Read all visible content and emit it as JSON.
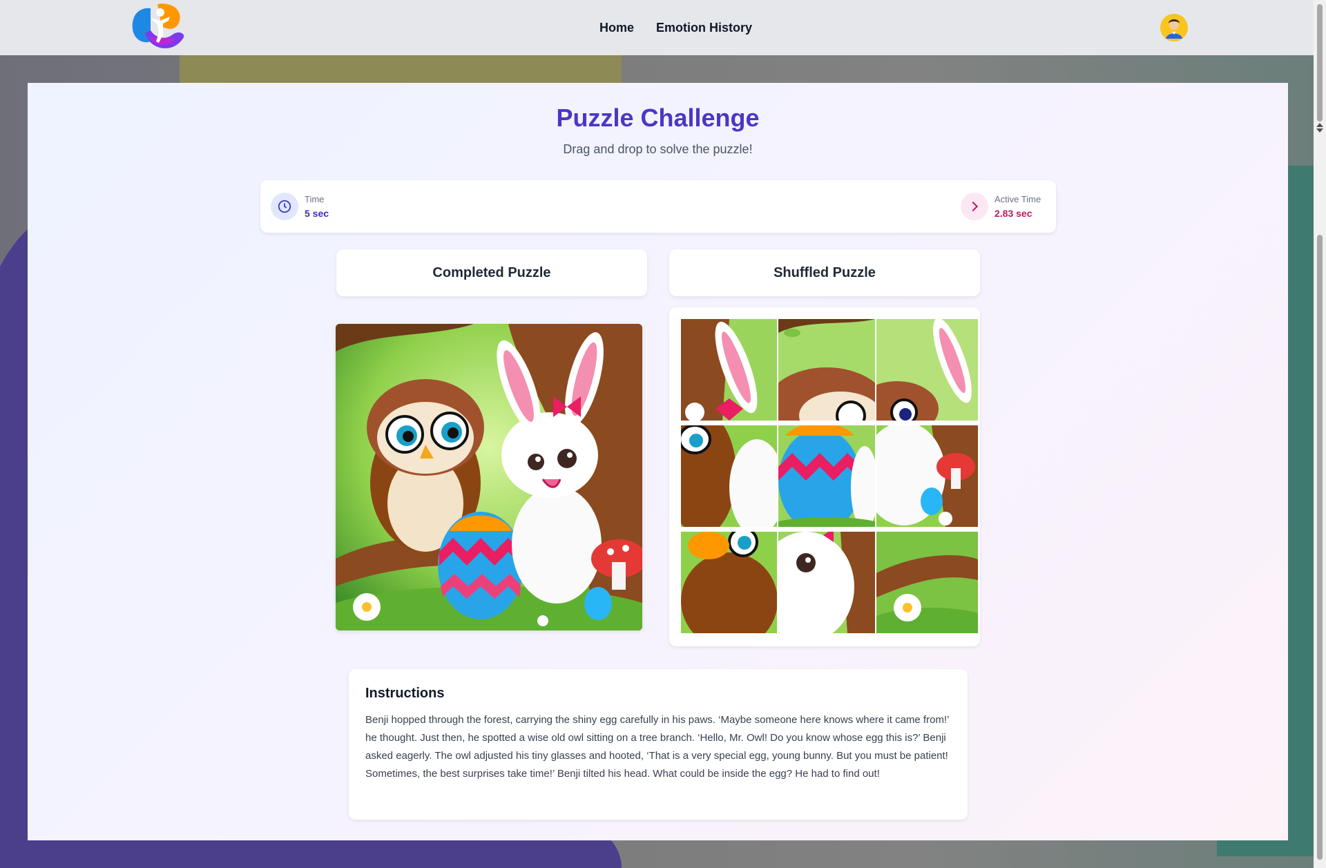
{
  "nav": {
    "home": "Home",
    "emotion_history": "Emotion History"
  },
  "page": {
    "title": "Puzzle Challenge",
    "subtitle": "Drag and drop to solve the puzzle!"
  },
  "stats": {
    "time_label": "Time",
    "time_value": "5 sec",
    "active_label": "Active Time",
    "active_value": "2.83 sec"
  },
  "puzzle": {
    "completed_title": "Completed Puzzle",
    "shuffled_title": "Shuffled Puzzle"
  },
  "instructions": {
    "title": "Instructions",
    "text": "Benji hopped through the forest, carrying the shiny egg carefully in his paws. ‘Maybe someone here knows where it came from!’ he thought. Just then, he spotted a wise old owl sitting on a tree branch. ‘Hello, Mr. Owl! Do you know whose egg this is?’ Benji asked eagerly. The owl adjusted his tiny glasses and hooted, ‘That is a very special egg, young bunny. But you must be patient! Sometimes, the best surprises take time!’ Benji tilted his head. What could be inside the egg? He had to find out!"
  },
  "colors": {
    "title": "#4c36c4",
    "time_value": "#3b2fb3",
    "active_value": "#be185d"
  },
  "icons": {
    "logo": "kid-logo-icon",
    "avatar": "user-avatar-icon",
    "time": "clock-icon",
    "active": "chevron-right-icon"
  }
}
